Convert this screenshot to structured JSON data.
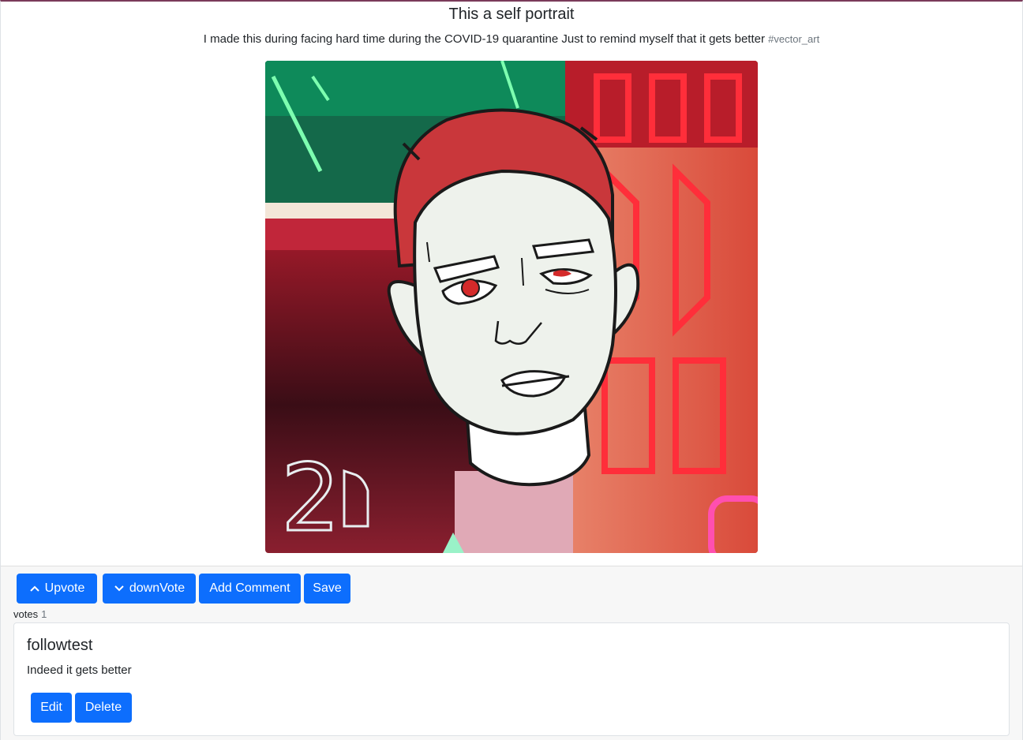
{
  "post": {
    "title": "This a self portrait",
    "description": "I made this during facing hard time during the COVID-19 quarantine Just to remind myself that it gets better",
    "tag": "#vector_art",
    "image_alt": "self portrait vector art",
    "image_label": "2"
  },
  "actions": {
    "upvote_label": "Upvote",
    "downvote_label": "downVote",
    "add_comment_label": "Add Comment",
    "save_label": "Save"
  },
  "votes": {
    "label": "votes",
    "count": "1"
  },
  "comments": [
    {
      "author": "followtest",
      "text": "Indeed it gets better",
      "edit_label": "Edit",
      "delete_label": "Delete"
    }
  ],
  "colors": {
    "primary": "#0d6efd",
    "footer_bg": "#f7f7f7",
    "hair": "#c9373b",
    "skin": "#eef2ec"
  }
}
